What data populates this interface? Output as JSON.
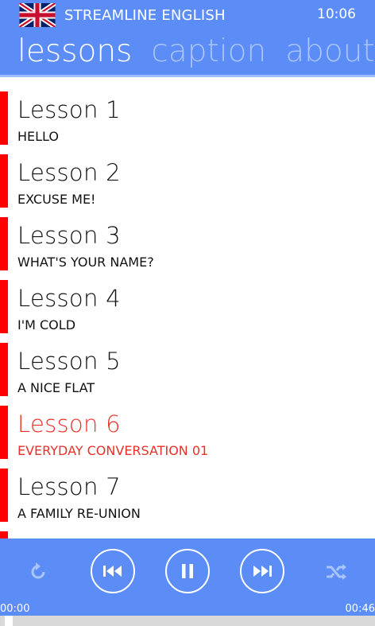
{
  "header": {
    "app_title": "STREAMLINE ENGLISH",
    "clock": "10:06",
    "flag_icon": "uk-flag-icon",
    "tabs": [
      {
        "label": "lessons",
        "active": true
      },
      {
        "label": "caption",
        "active": false
      },
      {
        "label": "about",
        "active": false
      }
    ]
  },
  "lessons": [
    {
      "title": "Lesson 1",
      "subtitle": "HELLO",
      "active": false
    },
    {
      "title": "Lesson 2",
      "subtitle": "EXCUSE ME!",
      "active": false
    },
    {
      "title": "Lesson 3",
      "subtitle": "WHAT'S YOUR NAME?",
      "active": false
    },
    {
      "title": "Lesson 4",
      "subtitle": "I'M COLD",
      "active": false
    },
    {
      "title": "Lesson 5",
      "subtitle": "A NICE FLAT",
      "active": false
    },
    {
      "title": "Lesson 6",
      "subtitle": "EVERYDAY CONVERSATION 01",
      "active": true
    },
    {
      "title": "Lesson 7",
      "subtitle": "A FAMILY RE-UNION",
      "active": false
    }
  ],
  "player": {
    "elapsed": "00:00",
    "duration": "00:46",
    "progress": 0.0,
    "controls": [
      "repeat-icon",
      "previous-icon",
      "pause-icon",
      "next-icon",
      "shuffle-icon"
    ]
  },
  "colors": {
    "accent": "#5c8df7",
    "lesson_bar": "#ff0000",
    "active_text": "#e8312a",
    "inactive_tab": "#a9c5fb"
  }
}
